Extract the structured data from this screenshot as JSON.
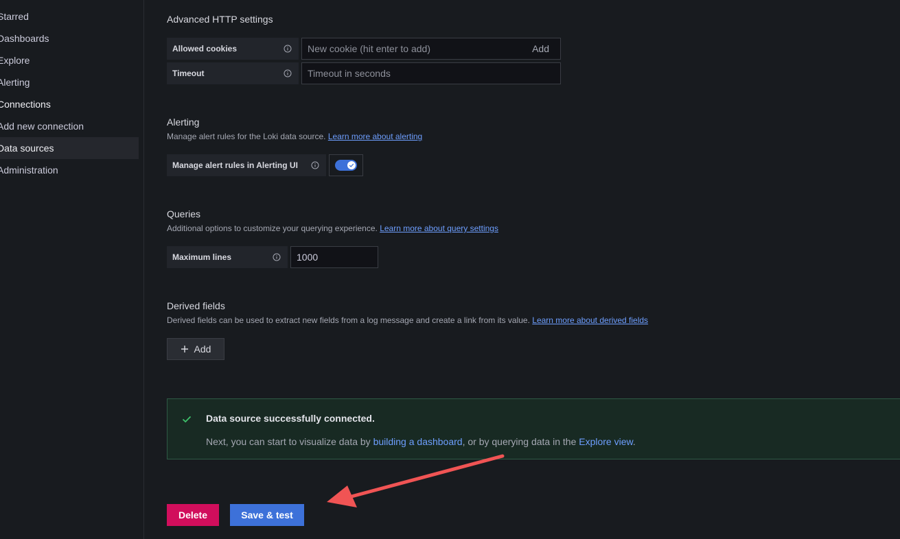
{
  "sidebar": {
    "items": [
      {
        "label": "Starred"
      },
      {
        "label": "Dashboards"
      },
      {
        "label": "Explore"
      },
      {
        "label": "Alerting"
      },
      {
        "label": "Connections"
      },
      {
        "label": "Add new connection"
      },
      {
        "label": "Data sources"
      },
      {
        "label": "Administration"
      }
    ]
  },
  "advanced_http": {
    "title": "Advanced HTTP settings",
    "allowed_cookies_label": "Allowed cookies",
    "cookie_placeholder": "New cookie (hit enter to add)",
    "cookie_add_label": "Add",
    "timeout_label": "Timeout",
    "timeout_placeholder": "Timeout in seconds"
  },
  "alerting": {
    "title": "Alerting",
    "description": "Manage alert rules for the Loki data source.",
    "link": "Learn more about alerting",
    "toggle_label": "Manage alert rules in Alerting UI",
    "toggle_on": true
  },
  "queries": {
    "title": "Queries",
    "description": "Additional options to customize your querying experience.",
    "link": "Learn more about query settings",
    "max_lines_label": "Maximum lines",
    "max_lines_value": "1000"
  },
  "derived_fields": {
    "title": "Derived fields",
    "description": "Derived fields can be used to extract new fields from a log message and create a link from its value.",
    "link": "Learn more about derived fields",
    "add_label": "Add"
  },
  "alert_box": {
    "title": "Data source successfully connected.",
    "body_prefix": "Next, you can start to visualize data by",
    "link_dashboard": "building a dashboard",
    "body_middle": ", or by querying data in the",
    "link_explore": "Explore view",
    "body_suffix": "."
  },
  "actions": {
    "delete_label": "Delete",
    "save_label": "Save & test"
  },
  "colors": {
    "background": "#181b1f",
    "primary": "#3d71d9",
    "destructive": "#d10e5c",
    "success": "#3ec26b",
    "link": "#6e9fff",
    "annotation_arrow": "#f05454"
  }
}
